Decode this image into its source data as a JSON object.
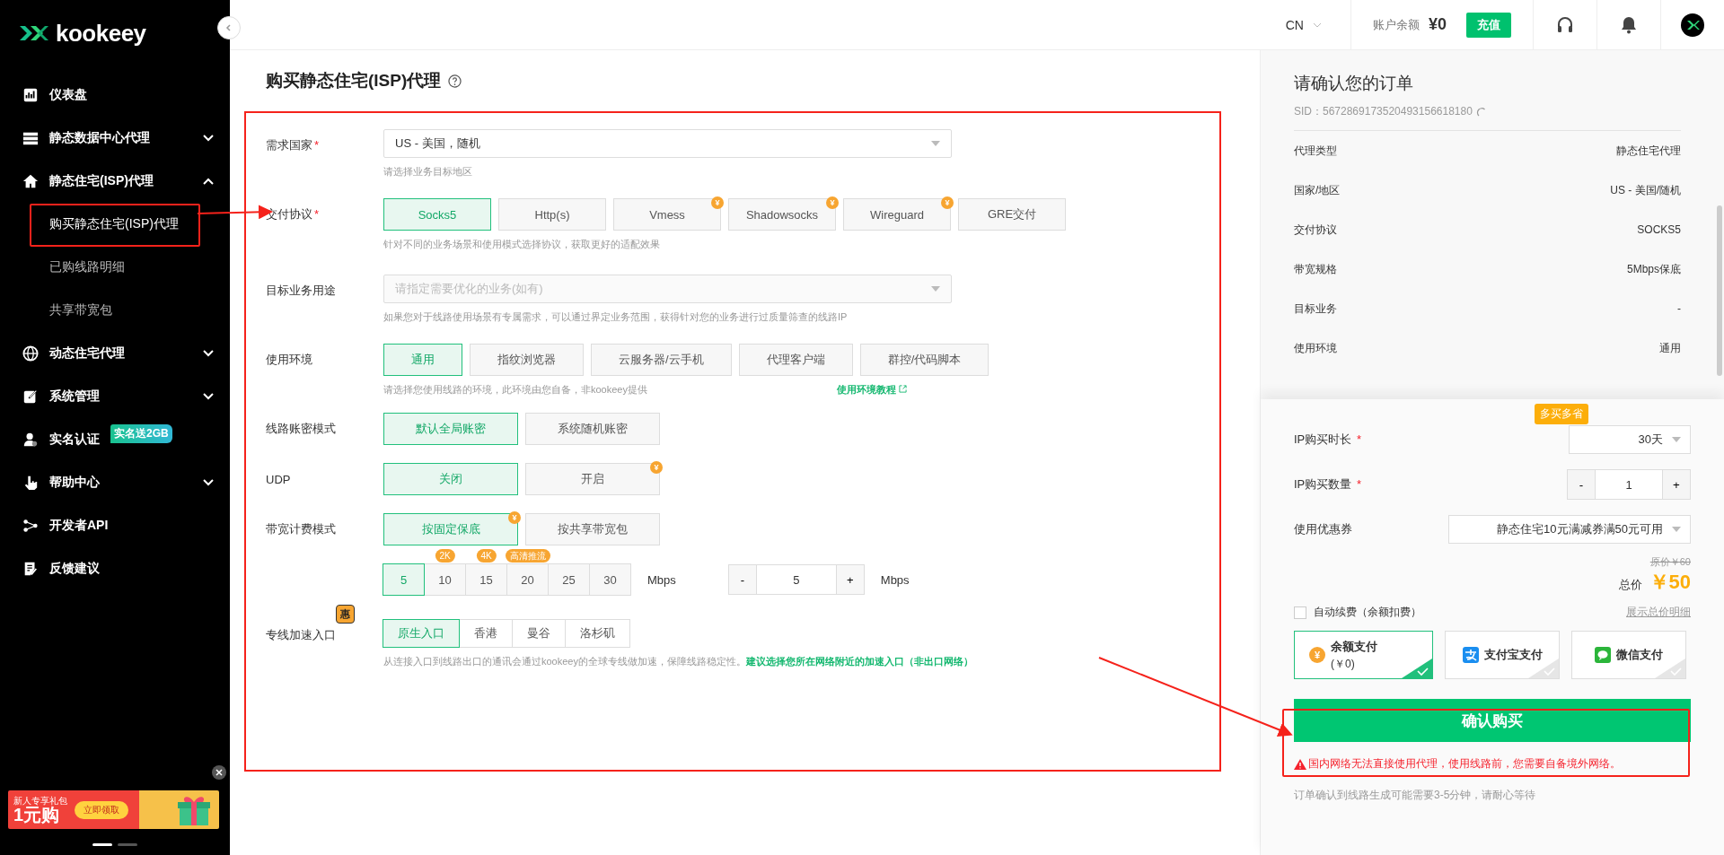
{
  "sidebar": {
    "logo": "kookeey",
    "items": [
      {
        "label": "仪表盘"
      },
      {
        "label": "静态数据中心代理",
        "expanded": false
      },
      {
        "label": "静态住宅(ISP)代理",
        "expanded": true,
        "children": [
          {
            "label": "购买静态住宅(ISP)代理",
            "selected": true
          },
          {
            "label": "已购线路明细",
            "selected": false
          },
          {
            "label": "共享带宽包",
            "selected": false
          }
        ]
      },
      {
        "label": "动态住宅代理",
        "expanded": false
      },
      {
        "label": "系统管理",
        "expanded": false
      },
      {
        "label": "实名认证",
        "badge": "实名送2GB"
      },
      {
        "label": "帮助中心",
        "expanded": false
      },
      {
        "label": "开发者API"
      },
      {
        "label": "反馈建议"
      }
    ],
    "promo": {
      "tag": "新人专享礼包",
      "price": "1元购",
      "button": "立即领取"
    },
    "pager": [
      {
        "selected": true
      },
      {
        "selected": false
      }
    ]
  },
  "header": {
    "language": "CN",
    "balance_label": "账户余额",
    "balance": "¥0",
    "recharge": "充值"
  },
  "form": {
    "title": "购买静态住宅(ISP)代理",
    "rows": [
      {
        "kind": "select",
        "label": "需求国家",
        "required_mark": "*",
        "value": "US - 美国，随机",
        "hint": "请选择业务目标地区"
      },
      {
        "kind": "options",
        "label": "交付协议",
        "required_mark": "*",
        "options": [
          {
            "label": "Socks5",
            "selected": true
          },
          {
            "label": "Http(s)",
            "selected": false
          },
          {
            "label": "Vmess",
            "selected": false,
            "badge": "¥"
          },
          {
            "label": "Shadowsocks",
            "selected": false,
            "badge": "¥"
          },
          {
            "label": "Wireguard",
            "selected": false,
            "badge": "¥"
          },
          {
            "label": "GRE交付",
            "selected": false
          }
        ],
        "hint": "针对不同的业务场景和使用模式选择协议，获取更好的适配效果"
      },
      {
        "kind": "select",
        "label": "目标业务用途",
        "placeholder": "请指定需要优化的业务(如有)",
        "hint": "如果您对于线路使用场景有专属需求，可以通过界定业务范围，获得针对您的业务进行过质量筛查的线路IP"
      },
      {
        "kind": "options",
        "label": "使用环境",
        "options": [
          {
            "label": "通用",
            "selected": true
          },
          {
            "label": "指纹浏览器",
            "selected": false
          },
          {
            "label": "云服务器/云手机",
            "selected": false
          },
          {
            "label": "代理客户端",
            "selected": false
          },
          {
            "label": "群控/代码脚本",
            "selected": false
          }
        ],
        "hint": "请选择您使用线路的环境，此环境由您自备，非kookeey提供",
        "link": "使用环境教程"
      },
      {
        "kind": "options",
        "label": "线路账密模式",
        "options": [
          {
            "label": "默认全局账密",
            "selected": true
          },
          {
            "label": "系统随机账密",
            "selected": false
          }
        ]
      },
      {
        "kind": "options",
        "label": "UDP",
        "options": [
          {
            "label": "关闭",
            "selected": true
          },
          {
            "label": "开启",
            "selected": false,
            "badge": "¥"
          }
        ]
      },
      {
        "kind": "options",
        "label": "带宽计费模式",
        "options": [
          {
            "label": "按固定保底",
            "selected": true,
            "badge": "¥"
          },
          {
            "label": "按共享带宽包",
            "selected": false
          }
        ]
      },
      {
        "kind": "speed",
        "options": [
          {
            "label": "5",
            "selected": true
          },
          {
            "label": "10",
            "selected": false,
            "tag": "2K"
          },
          {
            "label": "15",
            "selected": false,
            "tag": "4K"
          },
          {
            "label": "20",
            "selected": false,
            "tag": "高清推流"
          },
          {
            "label": "25",
            "selected": false
          },
          {
            "label": "30",
            "selected": false
          }
        ],
        "unit": "Mbps",
        "stepper": {
          "minus": "-",
          "value": "5",
          "plus": "+",
          "unit": "Mbps"
        }
      },
      {
        "kind": "segment",
        "label": "专线加速入口",
        "label_badge": "惠",
        "options": [
          {
            "label": "原生入口",
            "selected": true
          },
          {
            "label": "香港",
            "selected": false
          },
          {
            "label": "曼谷",
            "selected": false
          },
          {
            "label": "洛杉矶",
            "selected": false
          }
        ],
        "hint": "从连接入口到线路出口的通讯会通过kookeey的全球专线做加速，保障线路稳定性。",
        "hint_link": "建议选择您所在网络附近的加速入口（非出口网络）"
      }
    ]
  },
  "order": {
    "title": "请确认您的订单",
    "sid": "SID：5672869173520493156618180",
    "summary": [
      {
        "label": "代理类型",
        "value": "静态住宅代理"
      },
      {
        "label": "国家/地区",
        "value": "US - 美国/随机"
      },
      {
        "label": "交付协议",
        "value": "SOCKS5"
      },
      {
        "label": "带宽规格",
        "value": "5Mbps保底"
      },
      {
        "label": "目标业务",
        "value": "-"
      },
      {
        "label": "使用环境",
        "value": "通用"
      }
    ],
    "duration": {
      "label": "IP购买时长",
      "required_mark": "*",
      "value": "30天",
      "badge": "多买多省"
    },
    "quantity": {
      "label": "IP购买数量",
      "required_mark": "*",
      "minus": "-",
      "value": "1",
      "plus": "+"
    },
    "coupon": {
      "label": "使用优惠券",
      "value": "静态住宅10元满减券满50元可用"
    },
    "original_price": "原价￥60",
    "total_label": "总价",
    "total": "￥50",
    "auto_renew": {
      "label": "自动续费（余额扣费）",
      "checked": false
    },
    "details_link": "展示总价明细",
    "payments": [
      {
        "kind": "balance",
        "badge": "¥",
        "label": "余额支付",
        "sub": "(￥0)",
        "selected": true
      },
      {
        "kind": "alipay",
        "label": "支付宝支付",
        "selected": false
      },
      {
        "kind": "wechat",
        "label": "微信支付",
        "selected": false
      }
    ],
    "confirm": "确认购买",
    "warning": "国内网络无法直接使用代理，使用线路前，您需要自备境外网络。",
    "note": "订单确认到线路生成可能需要3-5分钟，请耐心等待"
  }
}
